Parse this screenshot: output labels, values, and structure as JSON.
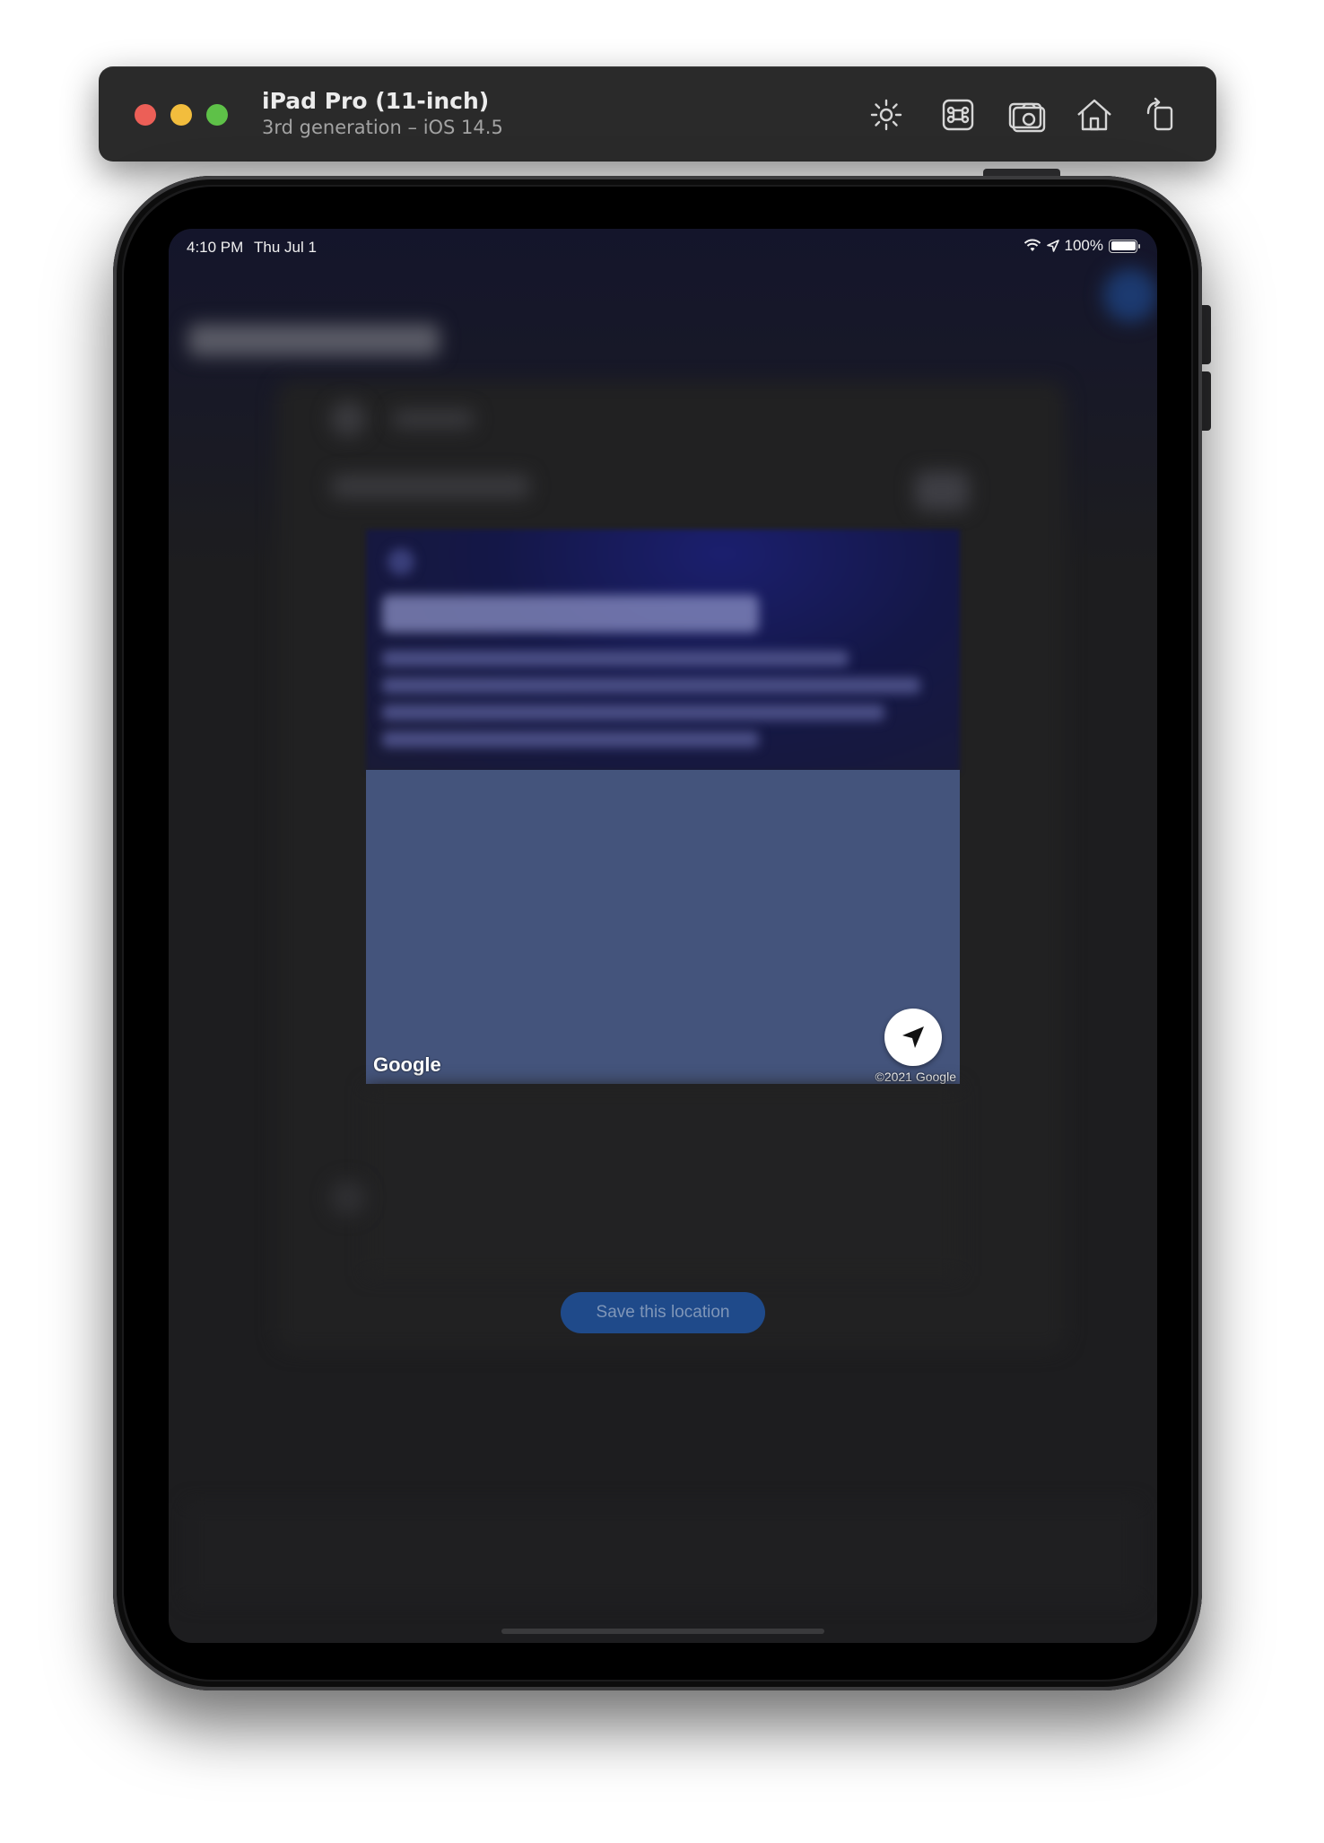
{
  "simulator": {
    "title": "iPad Pro (11-inch)",
    "subtitle": "3rd generation – iOS 14.5",
    "toolbar_icons": [
      "brightness-icon",
      "command-key-icon",
      "screenshot-camera-icon",
      "home-icon",
      "rotate-icon"
    ]
  },
  "status_bar": {
    "time": "4:10 PM",
    "date": "Thu Jul 1",
    "battery": "100%",
    "battery_level": 1.0
  },
  "map": {
    "logo": "Google",
    "copyright": "©2021 Google",
    "locate_icon": "location-arrow-icon"
  },
  "save_button": {
    "label": "Save this location"
  }
}
